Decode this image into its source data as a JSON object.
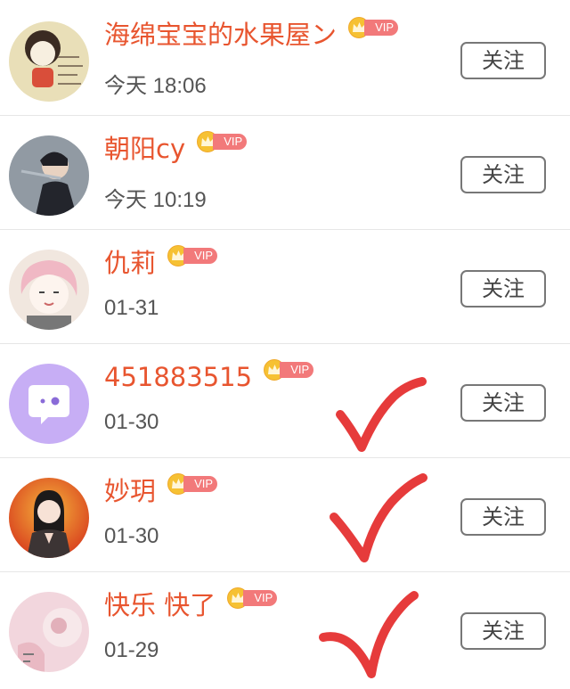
{
  "users": [
    {
      "name": "海绵宝宝的水果屋ン",
      "vip": "VIP",
      "time": "今天 18:06",
      "follow_label": "关注",
      "avatar_color": "#e9dfb8"
    },
    {
      "name": "朝阳cy",
      "vip": "VIP",
      "time": "今天 10:19",
      "follow_label": "关注",
      "avatar_color": "#5f6a74"
    },
    {
      "name": "仇莉",
      "vip": "VIP",
      "time": "01-31",
      "follow_label": "关注",
      "avatar_color": "#f1e7df"
    },
    {
      "name": "451883515",
      "vip": "VIP",
      "time": "01-30",
      "follow_label": "关注",
      "avatar_color": "#c7aef5"
    },
    {
      "name": "妙玥",
      "vip": "VIP",
      "time": "01-30",
      "follow_label": "关注",
      "avatar_color": "#e0632a"
    },
    {
      "name": "快乐 快了",
      "vip": "VIP",
      "time": "01-29",
      "follow_label": "关注",
      "avatar_color": "#f2d6dd"
    }
  ],
  "colors": {
    "name": "#e8552f",
    "vip_tag": "#f2797a",
    "crown": "#f6c133",
    "checkmark": "#e63b3b"
  }
}
